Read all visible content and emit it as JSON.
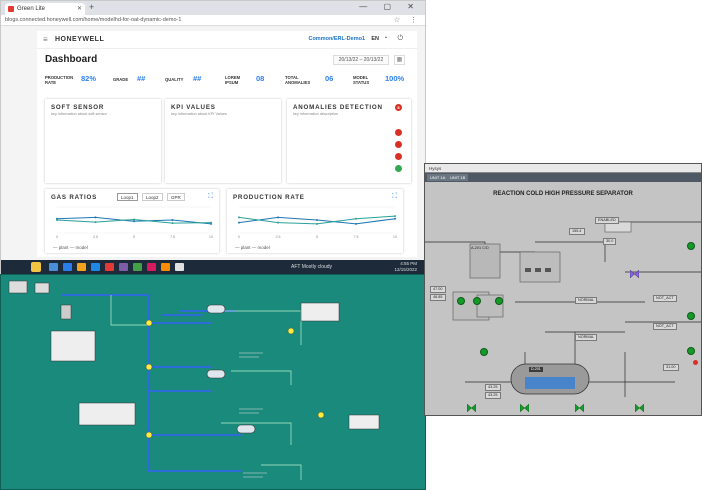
{
  "browser": {
    "tab_title": "Green Lite",
    "url": "blogs.connected.honeywell.com/home/modelhd-for-oat-dynamic-demo-1",
    "window_controls": "—  ▢  ✕"
  },
  "app": {
    "brand": "HONEYWELL",
    "user_menu": "Common/ERL-Demo1",
    "language": "EN",
    "page_title": "Dashboard",
    "date_range": "20/13/22 – 20/13/22",
    "kpis": [
      {
        "label": "PRODUCTION RATE",
        "value": "82%"
      },
      {
        "label": "GRADE",
        "value": "##"
      },
      {
        "label": "QUALITY",
        "value": "##"
      },
      {
        "label": "LOREM IPSUM",
        "value": "08"
      },
      {
        "label": "TOTAL ANOMALIES",
        "value": "06"
      },
      {
        "label": "MODEL STATUS",
        "value": "100%"
      }
    ],
    "soft_sensor": {
      "title": "SOFT SENSOR",
      "subtitle": "key information about soft sensor"
    },
    "kpi_values": {
      "title": "KPI VALUES",
      "subtitle": "key information about KPI Values"
    },
    "anomalies": {
      "title": "ANOMALIES DETECTION",
      "subtitle": "key information description",
      "indicator_top": "8"
    },
    "gas_ratios": {
      "title": "GAS RATIOS",
      "tabs": [
        "Loop1",
        "Loop2",
        "GPR"
      ],
      "legend": "— plant  — model"
    },
    "production_rate": {
      "title": "PRODUCTION RATE",
      "legend": "— plant  — model"
    }
  },
  "taskbar": {
    "task_label": "AFT Mostly cloudy",
    "clock_time": "4:55 PM",
    "clock_date": "12/15/2022"
  },
  "hmi": {
    "window_title": "Hysys",
    "tabs": [
      "UNIT 1A",
      "UNIT 1B"
    ],
    "title": "REACTION COLD HIGH PRESSURE SEPARATOR",
    "labels": {
      "enabled": "ENABLED",
      "normal1": "NORMAL",
      "normal2": "NORMAL",
      "not_act1": "NOT_ACT",
      "not_act2": "NOT_ACT",
      "vessel_tag": "D-201",
      "pkg_tag": "A-201 C/D",
      "v1": "47.00",
      "v2": "46.85",
      "v3": "43.25",
      "v4": "43.25",
      "v5": "31.00",
      "v6": "155.4",
      "v7": "30.0"
    },
    "colors": {
      "background": "#c4c4c4",
      "run": "#159a2a",
      "alarm": "#d93025"
    }
  },
  "flow": {
    "colors": {
      "background": "#1a8a7d",
      "pipe": "#2c6bd8",
      "line": "#b8f2c8"
    }
  },
  "chart_data": [
    {
      "type": "line",
      "title": "GAS RATIOS",
      "x": [
        0,
        2.5,
        5,
        7.5,
        10
      ],
      "series": [
        {
          "name": "plant",
          "values": [
            0.55,
            0.6,
            0.45,
            0.5,
            0.35
          ]
        },
        {
          "name": "model",
          "values": [
            0.5,
            0.42,
            0.52,
            0.38,
            0.4
          ]
        }
      ]
    },
    {
      "type": "line",
      "title": "PRODUCTION RATE",
      "x": [
        0,
        2.5,
        5,
        7.5,
        10
      ],
      "series": [
        {
          "name": "plant",
          "values": [
            0.4,
            0.6,
            0.5,
            0.35,
            0.55
          ]
        },
        {
          "name": "model",
          "values": [
            0.6,
            0.4,
            0.35,
            0.55,
            0.65
          ]
        }
      ]
    }
  ]
}
